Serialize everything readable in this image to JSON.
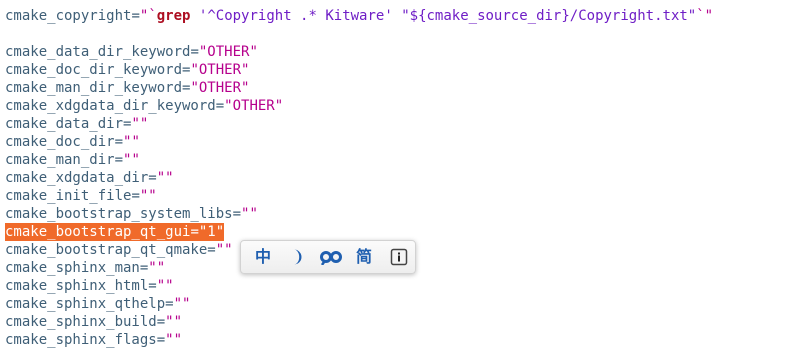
{
  "editor": {
    "lines": [
      [
        {
          "t": "cmake_copyright",
          "c": "var"
        },
        {
          "t": "=",
          "c": "op"
        },
        {
          "t": "\"",
          "c": "quote"
        },
        {
          "t": "`",
          "c": "quote"
        },
        {
          "t": "grep",
          "c": "kw"
        },
        {
          "t": " ",
          "c": "var"
        },
        {
          "t": "'^Copyright .* Kitware'",
          "c": "arg"
        },
        {
          "t": " ",
          "c": "var"
        },
        {
          "t": "\"${cmake_source_dir}/Copyright.txt\"",
          "c": "arg"
        },
        {
          "t": "`",
          "c": "quote"
        },
        {
          "t": "\"",
          "c": "quote"
        }
      ],
      [],
      [
        {
          "t": "cmake_data_dir_keyword",
          "c": "var"
        },
        {
          "t": "=",
          "c": "op"
        },
        {
          "t": "\"OTHER\"",
          "c": "str"
        }
      ],
      [
        {
          "t": "cmake_doc_dir_keyword",
          "c": "var"
        },
        {
          "t": "=",
          "c": "op"
        },
        {
          "t": "\"OTHER\"",
          "c": "str"
        }
      ],
      [
        {
          "t": "cmake_man_dir_keyword",
          "c": "var"
        },
        {
          "t": "=",
          "c": "op"
        },
        {
          "t": "\"OTHER\"",
          "c": "str"
        }
      ],
      [
        {
          "t": "cmake_xdgdata_dir_keyword",
          "c": "var"
        },
        {
          "t": "=",
          "c": "op"
        },
        {
          "t": "\"OTHER\"",
          "c": "str"
        }
      ],
      [
        {
          "t": "cmake_data_dir",
          "c": "var"
        },
        {
          "t": "=",
          "c": "op"
        },
        {
          "t": "\"\"",
          "c": "str"
        }
      ],
      [
        {
          "t": "cmake_doc_dir",
          "c": "var"
        },
        {
          "t": "=",
          "c": "op"
        },
        {
          "t": "\"\"",
          "c": "str"
        }
      ],
      [
        {
          "t": "cmake_man_dir",
          "c": "var"
        },
        {
          "t": "=",
          "c": "op"
        },
        {
          "t": "\"\"",
          "c": "str"
        }
      ],
      [
        {
          "t": "cmake_xdgdata_dir",
          "c": "var"
        },
        {
          "t": "=",
          "c": "op"
        },
        {
          "t": "\"\"",
          "c": "str"
        }
      ],
      [
        {
          "t": "cmake_init_file",
          "c": "var"
        },
        {
          "t": "=",
          "c": "op"
        },
        {
          "t": "\"\"",
          "c": "str"
        }
      ],
      [
        {
          "t": "cmake_bootstrap_system_libs",
          "c": "var"
        },
        {
          "t": "=",
          "c": "op"
        },
        {
          "t": "\"\"",
          "c": "str"
        }
      ],
      [
        {
          "t": "cmake_bootstrap_qt_gui",
          "c": "var"
        },
        {
          "t": "=",
          "c": "op"
        },
        {
          "t": "\"1\"",
          "c": "str"
        }
      ],
      [
        {
          "t": "cmake_bootstrap_qt_qmake",
          "c": "var"
        },
        {
          "t": "=",
          "c": "op"
        },
        {
          "t": "\"\"",
          "c": "str"
        }
      ],
      [
        {
          "t": "cmake_sphinx_man",
          "c": "var"
        },
        {
          "t": "=",
          "c": "op"
        },
        {
          "t": "\"\"",
          "c": "str"
        }
      ],
      [
        {
          "t": "cmake_sphinx_html",
          "c": "var"
        },
        {
          "t": "=",
          "c": "op"
        },
        {
          "t": "\"\"",
          "c": "str"
        }
      ],
      [
        {
          "t": "cmake_sphinx_qthelp",
          "c": "var"
        },
        {
          "t": "=",
          "c": "op"
        },
        {
          "t": "\"\"",
          "c": "str"
        }
      ],
      [
        {
          "t": "cmake_sphinx_build",
          "c": "var"
        },
        {
          "t": "=",
          "c": "op"
        },
        {
          "t": "\"\"",
          "c": "str"
        }
      ],
      [
        {
          "t": "cmake_sphinx_flags",
          "c": "var"
        },
        {
          "t": "=",
          "c": "op"
        },
        {
          "t": "\"\"",
          "c": "str"
        }
      ]
    ],
    "selected_line": 12
  },
  "ime_toolbar": {
    "buttons": [
      {
        "name": "chinese-mode-button",
        "icon": "chinese-mode-icon",
        "glyph": "中"
      },
      {
        "name": "fullwidth-toggle-button",
        "icon": "half-width-moon-icon",
        "glyph": ""
      },
      {
        "name": "punctuation-toggle-button",
        "icon": "punctuation-icon",
        "glyph": ""
      },
      {
        "name": "simplified-traditional-button",
        "icon": "simplified-chinese-icon",
        "glyph": "简"
      },
      {
        "name": "ime-info-button",
        "icon": "info-icon",
        "glyph": ""
      }
    ]
  },
  "colors": {
    "variable": "#3f5f77",
    "string": "#b6008c",
    "keyword": "#ad0f22",
    "argument": "#6f1ec6",
    "selection": "#f06a2a"
  }
}
